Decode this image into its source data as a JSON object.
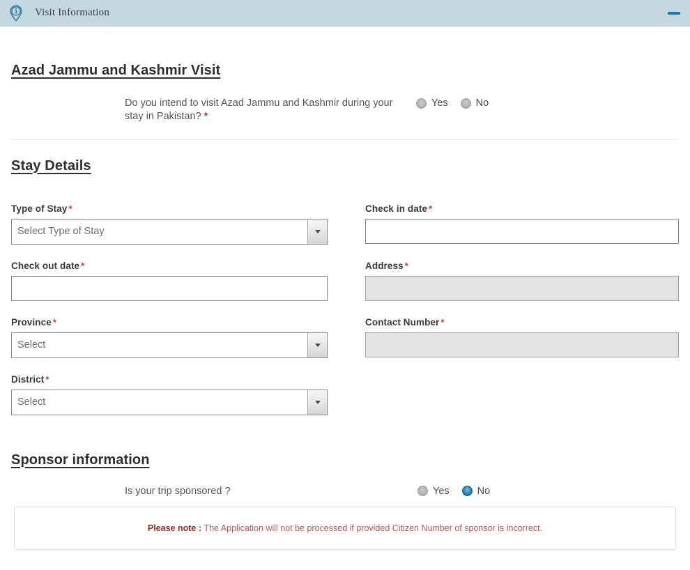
{
  "header": {
    "title": "Visit Information",
    "info_icon": "info-location-pin-icon",
    "minimize_icon": "minimize-icon",
    "bg_color": "#c5d8e2",
    "icon_color": "#1a7aae"
  },
  "ajk_section": {
    "title": "Azad Jammu and Kashmir Visit",
    "question": "Do you intend to visit Azad Jammu and Kashmir during your stay in Pakistan?",
    "required_marker": "*",
    "options": [
      {
        "label": "Yes",
        "selected": false
      },
      {
        "label": "No",
        "selected": false
      }
    ]
  },
  "stay_section": {
    "title": "Stay Details",
    "fields": {
      "type_of_stay": {
        "label": "Type of Stay",
        "required_marker": "*",
        "value": "Select Type of Stay",
        "control": "select"
      },
      "check_in_date": {
        "label": "Check in date",
        "required_marker": "*",
        "value": "",
        "placeholder": "",
        "control": "text"
      },
      "check_out_date": {
        "label": "Check out date",
        "required_marker": "*",
        "value": "",
        "placeholder": "",
        "control": "text"
      },
      "address": {
        "label": "Address",
        "required_marker": "*",
        "value": "",
        "placeholder": "",
        "control": "text",
        "disabled": true
      },
      "province": {
        "label": "Province",
        "required_marker": "*",
        "value": "Select",
        "control": "select"
      },
      "contact_number": {
        "label": "Contact Number",
        "required_marker": "*",
        "value": "",
        "placeholder": "",
        "control": "text",
        "disabled": true
      },
      "district": {
        "label": "District",
        "required_marker": "*",
        "value": "Select",
        "control": "select"
      }
    }
  },
  "sponsor_section": {
    "title": "Sponsor information",
    "question": "Is your trip sponsored ?",
    "options": [
      {
        "label": "Yes",
        "selected": false
      },
      {
        "label": "No",
        "selected": true
      }
    ],
    "note_prefix": "Please note : ",
    "note_body": "The Application will not be processed if provided Citizen Number of sponsor is incorrect.",
    "note_color": "#c0564f",
    "note_prefix_color": "#9c2b25"
  }
}
